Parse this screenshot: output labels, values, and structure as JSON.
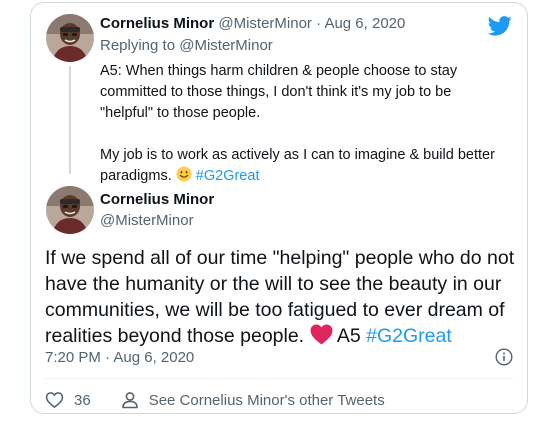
{
  "reply": {
    "name": "Cornelius Minor",
    "handle": "@MisterMinor",
    "separator": "·",
    "date": "Aug 6, 2020",
    "replying_prefix": "Replying to",
    "replying_to": "@MisterMinor",
    "paragraph1": "A5: When things harm children & people choose to stay committed to those things, I don't think it's my job to be \"helpful\" to those people.",
    "paragraph2_text": "My job is to work as actively as I can to imagine & build better paradigms.",
    "hashtag": "#G2Great"
  },
  "tweet": {
    "name": "Cornelius Minor",
    "handle": "@MisterMinor",
    "text": "If we spend all of our time \"helping\" people who do not have the humanity or the will to see the beauty in our communities, we will be too fatigued to ever dream of realities beyond those people.",
    "after_heart": "A5",
    "hashtag": "#G2Great",
    "timestamp": "7:20 PM · Aug 6, 2020"
  },
  "actions": {
    "likes": "36",
    "other_tweets_label": "See Cornelius Minor's other Tweets"
  },
  "colors": {
    "accent": "#1d9bf0",
    "muted": "#536471",
    "heart": "#e0245e",
    "border": "#cfd9de"
  },
  "icons": [
    "avatar",
    "twitter-bird-icon",
    "smiley-emoji-icon",
    "red-heart-emoji-icon",
    "info-icon",
    "heart-outline-icon",
    "user-icon"
  ]
}
